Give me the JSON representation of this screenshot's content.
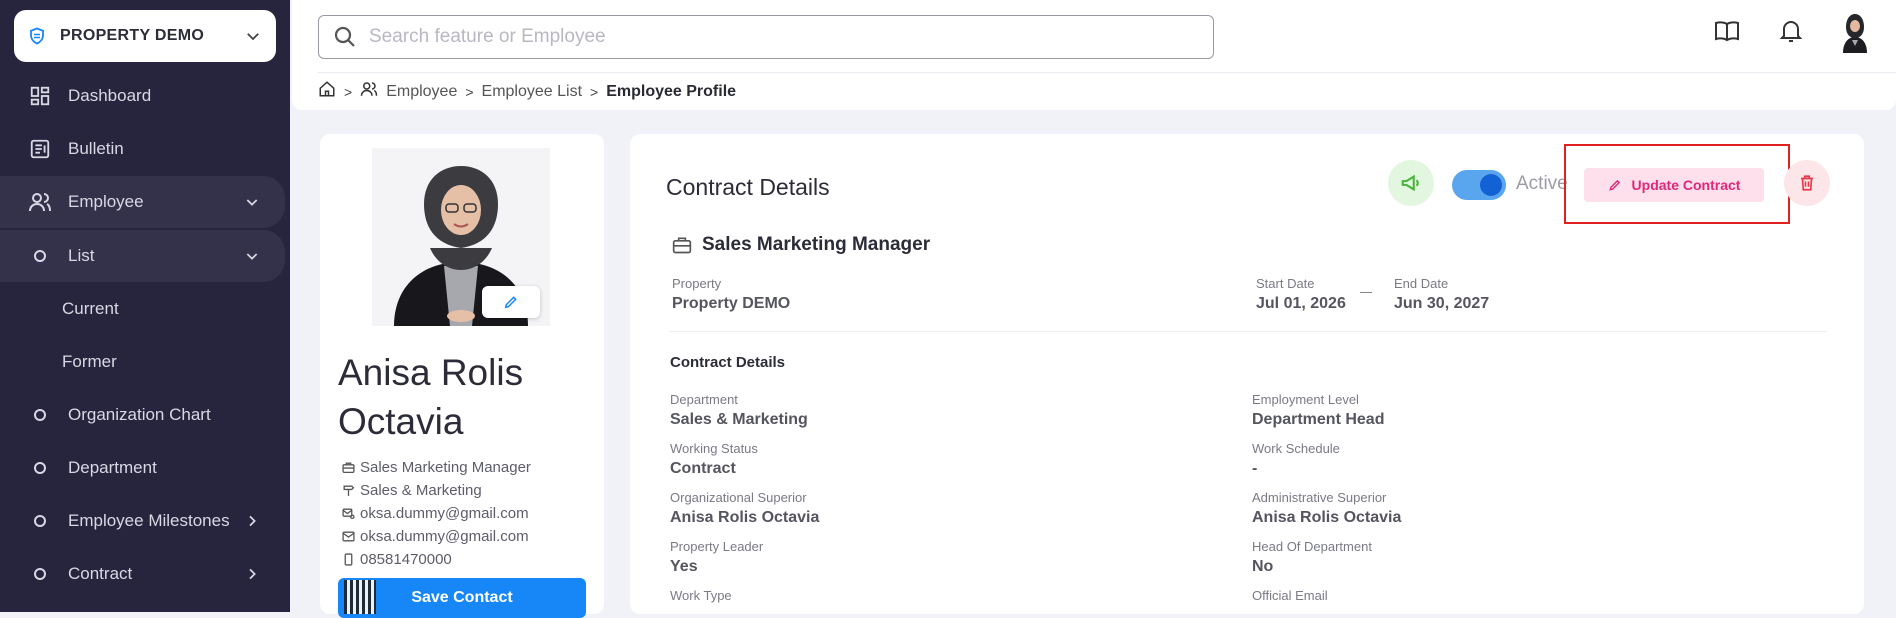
{
  "sidebar": {
    "property_name": "PROPERTY DEMO",
    "items": [
      {
        "label": "Dashboard"
      },
      {
        "label": "Bulletin"
      },
      {
        "label": "Employee"
      },
      {
        "label": "List"
      },
      {
        "label": "Current"
      },
      {
        "label": "Former"
      },
      {
        "label": "Organization Chart"
      },
      {
        "label": "Department"
      },
      {
        "label": "Employee Milestones"
      },
      {
        "label": "Contract"
      }
    ]
  },
  "header": {
    "search_placeholder": "Search feature or Employee",
    "breadcrumb": [
      "Employee",
      "Employee List",
      "Employee Profile"
    ]
  },
  "profile": {
    "name": "Anisa Rolis Octavia",
    "position": "Sales Marketing Manager",
    "department": "Sales & Marketing",
    "email_1": "oksa.dummy@gmail.com",
    "email_2": "oksa.dummy@gmail.com",
    "phone": "08581470000",
    "save_label": "Save Contact"
  },
  "contract": {
    "title": "Contract Details",
    "status_label": "Active",
    "toggle_on": true,
    "update_label": "Update Contract",
    "job_title": "Sales Marketing Manager",
    "property_label": "Property",
    "property_value": "Property DEMO",
    "start_label": "Start Date",
    "start_value": "Jul 01, 2026",
    "end_label": "End Date",
    "end_value": "Jun 30, 2027",
    "section_title": "Contract Details",
    "fields": [
      {
        "label": "Department",
        "value": "Sales & Marketing"
      },
      {
        "label": "Employment Level",
        "value": "Department Head"
      },
      {
        "label": "Working Status",
        "value": "Contract"
      },
      {
        "label": "Work Schedule",
        "value": "-"
      },
      {
        "label": "Organizational Superior",
        "value": "Anisa Rolis Octavia"
      },
      {
        "label": "Administrative Superior",
        "value": "Anisa Rolis Octavia"
      },
      {
        "label": "Property Leader",
        "value": "Yes"
      },
      {
        "label": "Head Of Department",
        "value": "No"
      },
      {
        "label": "Work Type",
        "value": ""
      },
      {
        "label": "Official Email",
        "value": ""
      }
    ]
  },
  "colors": {
    "sidebar_bg": "#27253d",
    "primary": "#1786f7",
    "update_accent": "#e0287a",
    "highlight": "#e32020"
  }
}
